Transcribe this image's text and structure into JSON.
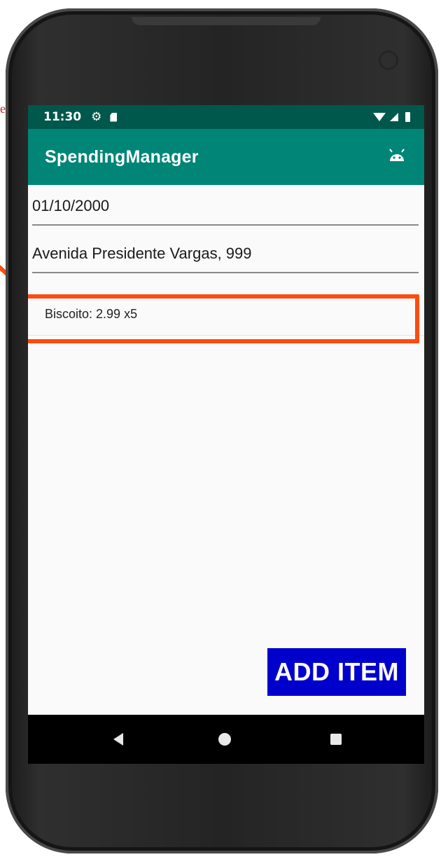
{
  "annotation": {
    "text": "e"
  },
  "status_bar": {
    "time": "11:30"
  },
  "toolbar": {
    "title": "SpendingManager",
    "icon": "android-icon"
  },
  "form": {
    "date_value": "01/10/2000",
    "address_value": "Avenida Presidente Vargas, 999"
  },
  "items": [
    {
      "label": "Biscoito: 2.99 x5"
    }
  ],
  "actions": {
    "add_item_label": "ADD ITEM"
  },
  "colors": {
    "status_bar": "#00574b",
    "toolbar": "#008577",
    "button": "#0000cc",
    "highlight": "#ff4a10"
  }
}
